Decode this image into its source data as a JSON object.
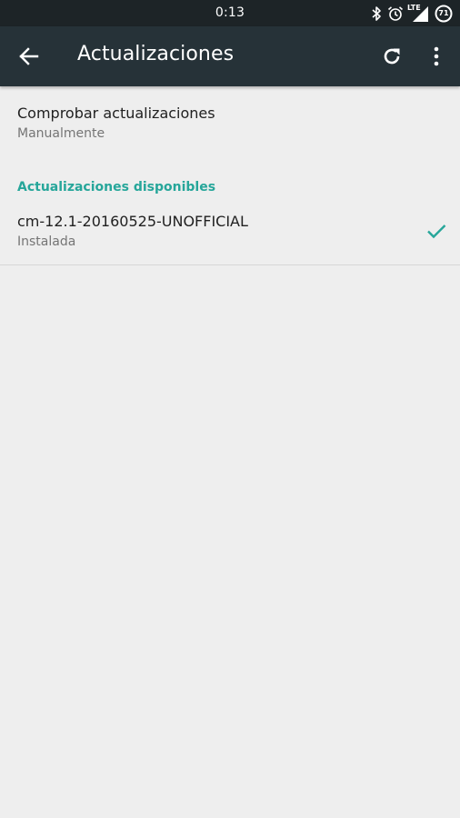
{
  "status_bar": {
    "time": "0:13",
    "network_label": "LTE",
    "battery_level": "71",
    "icons": [
      "bluetooth-icon",
      "alarm-icon",
      "lte-signal-icon",
      "battery-icon"
    ]
  },
  "app_bar": {
    "title": "Actualizaciones",
    "icons": [
      "back-arrow-icon",
      "refresh-icon",
      "overflow-menu-icon"
    ],
    "background_color": "#263238"
  },
  "preferences": {
    "check_updates": {
      "title": "Comprobar actualizaciones",
      "summary": "Manualmente"
    },
    "category": {
      "title": "Actualizaciones disponibles",
      "color": "#26a69a"
    },
    "updates": [
      {
        "name": "cm-12.1-20160525-UNOFFICIAL",
        "status": "Instalada",
        "icon": "checkmark-icon"
      }
    ]
  }
}
